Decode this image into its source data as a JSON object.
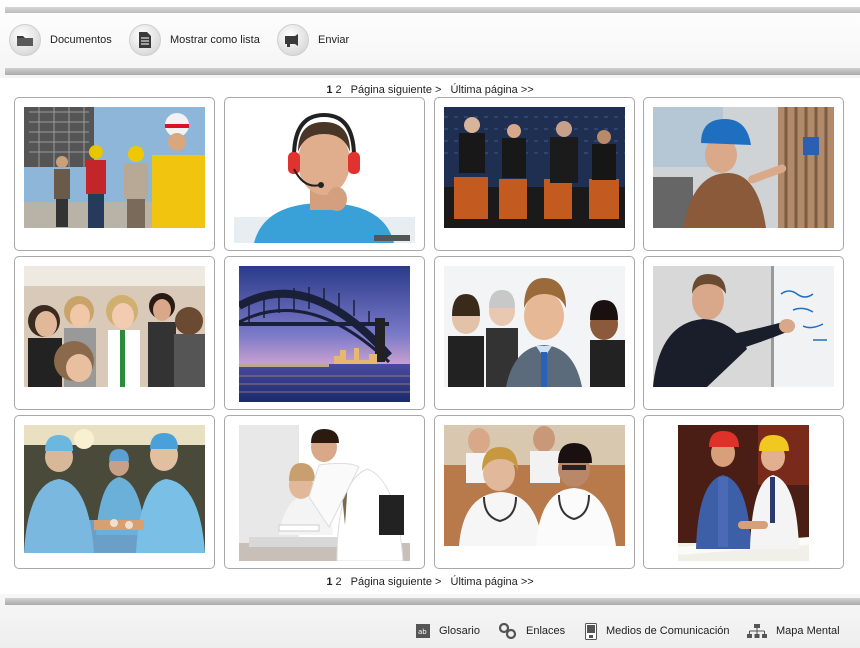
{
  "toolbar": {
    "documents_label": "Documentos",
    "list_label": "Mostrar como lista",
    "send_label": "Enviar"
  },
  "pagination": {
    "current_page": "1",
    "page_2": "2",
    "next_label": "Página siguiente >",
    "last_label": "Última página >>"
  },
  "thumbnails": [
    {
      "subject": "construction workers with hard hats at a building site"
    },
    {
      "subject": "man wearing a headset with microphone"
    },
    {
      "subject": "panel of speakers seated on a stage"
    },
    {
      "subject": "woman in a blue hard hat working at a wall"
    },
    {
      "subject": "group of students smiling"
    },
    {
      "subject": "harbour bridge at dusk over city skyline"
    },
    {
      "subject": "businessman in front of a team"
    },
    {
      "subject": "man in suit writing on a whiteboard"
    },
    {
      "subject": "surgeons operating in an operating room"
    },
    {
      "subject": "man in shirt and tie helping a woman at a desk"
    },
    {
      "subject": "doctors in white coats with stethoscopes"
    },
    {
      "subject": "two workers with hard hats reviewing plans"
    }
  ],
  "footer": {
    "glossary_label": "Glosario",
    "links_label": "Enlaces",
    "media_label": "Medios de Comunicación",
    "mindmap_label": "Mapa Mental"
  },
  "icons": {
    "documents": "folder-icon",
    "list": "document-list-icon",
    "send": "send-icon",
    "glossary": "glossary-icon",
    "links": "links-icon",
    "media": "media-icon",
    "mindmap": "mindmap-icon"
  }
}
